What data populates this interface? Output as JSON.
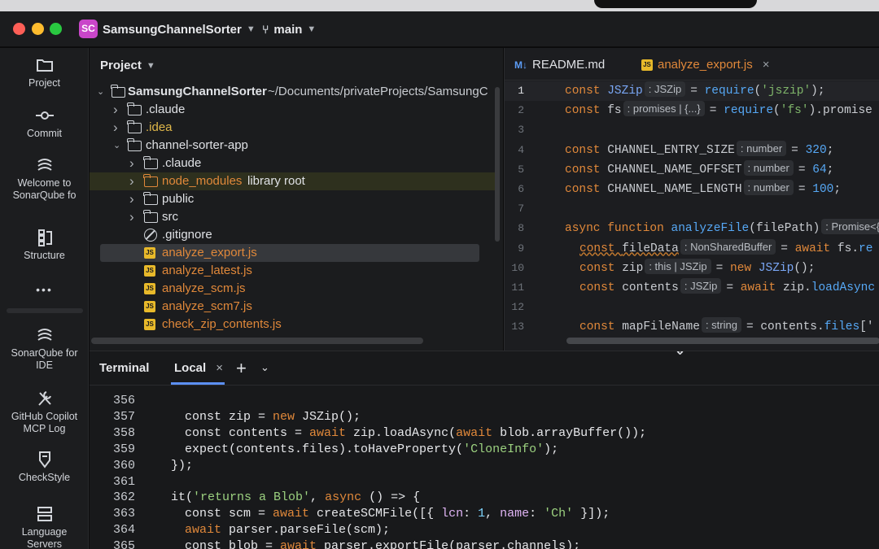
{
  "window": {
    "project_badge": "SC",
    "project_name": "SamsungChannelSorter",
    "branch": "main"
  },
  "toolstrip": {
    "items": [
      {
        "label": "Project",
        "icon": "folder-icon"
      },
      {
        "label": "Commit",
        "icon": "commit-icon"
      },
      {
        "label": "Welcome to SonarQube fo",
        "icon": "sonarqube-icon"
      },
      {
        "label": "Structure",
        "icon": "structure-icon"
      },
      {
        "label": "•••",
        "icon": "more-icon"
      },
      {
        "label": "SonarQube for IDE",
        "icon": "sonarqube-icon"
      },
      {
        "label": "GitHub Copilot MCP Log",
        "icon": "wrench-icon"
      },
      {
        "label": "CheckStyle",
        "icon": "checkstyle-icon"
      },
      {
        "label": "Language Servers",
        "icon": "servers-icon"
      }
    ]
  },
  "project_panel": {
    "title": "Project",
    "root": {
      "name": "SamsungChannelSorter",
      "path": "~/Documents/privateProjects/SamsungC"
    },
    "rows": [
      {
        "name": ".claude",
        "type": "folder",
        "level": 1,
        "arrow": "›"
      },
      {
        "name": ".idea",
        "type": "folder",
        "level": 1,
        "arrow": "›",
        "color": "#e0b84a"
      },
      {
        "name": "channel-sorter-app",
        "type": "folder",
        "level": 1,
        "arrow": "⌄"
      },
      {
        "name": ".claude",
        "type": "folder",
        "level": 2,
        "arrow": "›"
      },
      {
        "name": "node_modules",
        "type": "folder-orange",
        "level": 2,
        "arrow": "›",
        "suffix": "library root",
        "color": "#e0883a"
      },
      {
        "name": "public",
        "type": "folder",
        "level": 2,
        "arrow": "›"
      },
      {
        "name": "src",
        "type": "folder",
        "level": 2,
        "arrow": "›"
      },
      {
        "name": ".gitignore",
        "type": "ignore",
        "level": 2
      },
      {
        "name": "analyze_export.js",
        "type": "js",
        "level": 2,
        "color": "#e0883a"
      },
      {
        "name": "analyze_latest.js",
        "type": "js",
        "level": 2,
        "color": "#e0883a"
      },
      {
        "name": "analyze_scm.js",
        "type": "js",
        "level": 2,
        "color": "#e0883a"
      },
      {
        "name": "analyze_scm7.js",
        "type": "js",
        "level": 2,
        "color": "#e0883a"
      },
      {
        "name": "check_zip_contents.js",
        "type": "js",
        "level": 2,
        "color": "#e0883a"
      }
    ]
  },
  "editor": {
    "tabs": [
      {
        "badge": "M↓",
        "label": "README.md"
      },
      {
        "badge": "JS",
        "label": "analyze_export.js",
        "close": "×"
      }
    ],
    "lines": [
      {
        "n": "1",
        "parts": [
          [
            "kw",
            "const "
          ],
          [
            "blue",
            "JSZip"
          ],
          [
            "hint",
            ": JSZip"
          ],
          [
            "",
            "= "
          ],
          [
            "fn",
            "require"
          ],
          [
            "",
            "("
          ],
          [
            "str",
            "'jszip'"
          ],
          [
            "",
            ");"
          ]
        ]
      },
      {
        "n": "2",
        "parts": [
          [
            "kw",
            "const "
          ],
          [
            "",
            "fs"
          ],
          [
            "hint",
            ": promises | {...}"
          ],
          [
            "",
            "= "
          ],
          [
            "fn",
            "require"
          ],
          [
            "",
            "("
          ],
          [
            "str",
            "'fs'"
          ],
          [
            "",
            ").promise"
          ]
        ]
      },
      {
        "n": "3",
        "parts": []
      },
      {
        "n": "4",
        "parts": [
          [
            "kw",
            "const "
          ],
          [
            "",
            "CHANNEL_ENTRY_SIZE"
          ],
          [
            "hint",
            ": number"
          ],
          [
            "",
            "= "
          ],
          [
            "num",
            "320"
          ],
          [
            "",
            ";"
          ]
        ]
      },
      {
        "n": "5",
        "parts": [
          [
            "kw",
            "const "
          ],
          [
            "",
            "CHANNEL_NAME_OFFSET"
          ],
          [
            "hint",
            ": number"
          ],
          [
            "",
            "= "
          ],
          [
            "num",
            "64"
          ],
          [
            "",
            ";"
          ]
        ]
      },
      {
        "n": "6",
        "parts": [
          [
            "kw",
            "const "
          ],
          [
            "",
            "CHANNEL_NAME_LENGTH"
          ],
          [
            "hint",
            ": number"
          ],
          [
            "",
            "= "
          ],
          [
            "num",
            "100"
          ],
          [
            "",
            ";"
          ]
        ]
      },
      {
        "n": "7",
        "parts": []
      },
      {
        "n": "8",
        "parts": [
          [
            "kw",
            "async function "
          ],
          [
            "fn",
            "analyzeFile"
          ],
          [
            "",
            "(filePath)"
          ],
          [
            "hint",
            ": Promise<{"
          ]
        ]
      },
      {
        "n": "9",
        "indent": true,
        "parts": [
          [
            "kw squig",
            "const "
          ],
          [
            "squig",
            "fileData"
          ],
          [
            "hint",
            ": NonSharedBuffer"
          ],
          [
            "",
            "= "
          ],
          [
            "kw",
            "await "
          ],
          [
            "",
            "fs."
          ],
          [
            "fn",
            "re"
          ]
        ]
      },
      {
        "n": "10",
        "indent": true,
        "parts": [
          [
            "kw",
            "const "
          ],
          [
            "",
            "zip"
          ],
          [
            "hint",
            ": this | JSZip"
          ],
          [
            "",
            "= "
          ],
          [
            "kw",
            "new "
          ],
          [
            "blue",
            "JSZip"
          ],
          [
            "",
            "();"
          ]
        ]
      },
      {
        "n": "11",
        "indent": true,
        "parts": [
          [
            "kw",
            "const "
          ],
          [
            "",
            "contents"
          ],
          [
            "hint",
            ": JSZip"
          ],
          [
            "",
            "= "
          ],
          [
            "kw",
            "await "
          ],
          [
            "",
            "zip."
          ],
          [
            "fn",
            "loadAsync"
          ]
        ]
      },
      {
        "n": "12",
        "parts": []
      },
      {
        "n": "13",
        "indent": true,
        "parts": [
          [
            "kw",
            "const "
          ],
          [
            "",
            "mapFileName"
          ],
          [
            "hint",
            ": string"
          ],
          [
            "",
            "= "
          ],
          [
            "",
            "contents."
          ],
          [
            "fn",
            "files"
          ],
          [
            "",
            "['"
          ]
        ]
      }
    ]
  },
  "terminal": {
    "title": "Terminal",
    "tab_label": "Local",
    "tab_close": "×",
    "add_label": "+",
    "more_label": "⌄",
    "lines": [
      {
        "n": "356",
        "parts": []
      },
      {
        "n": "357",
        "i2": true,
        "parts": [
          [
            "",
            "const zip = "
          ],
          [
            "kw",
            "new "
          ],
          [
            "",
            "JSZip();"
          ]
        ]
      },
      {
        "n": "358",
        "i2": true,
        "parts": [
          [
            "",
            "const contents = "
          ],
          [
            "kw",
            "await "
          ],
          [
            "",
            "zip.loadAsync("
          ],
          [
            "kw",
            "await "
          ],
          [
            "",
            "blob.arrayBuffer());"
          ]
        ]
      },
      {
        "n": "359",
        "i2": true,
        "parts": [
          [
            "",
            "expect(contents.files).toHaveProperty("
          ],
          [
            "str",
            "'CloneInfo'"
          ],
          [
            "",
            ");"
          ]
        ]
      },
      {
        "n": "360",
        "parts": [
          [
            "",
            "});"
          ]
        ]
      },
      {
        "n": "361",
        "parts": []
      },
      {
        "n": "362",
        "parts": [
          [
            "",
            "it("
          ],
          [
            "str",
            "'returns a Blob'"
          ],
          [
            "",
            ", "
          ],
          [
            "kw",
            "async "
          ],
          [
            "",
            "() => {"
          ]
        ]
      },
      {
        "n": "363",
        "i2": true,
        "parts": [
          [
            "",
            "const scm = "
          ],
          [
            "kw",
            "await "
          ],
          [
            "",
            "createSCMFile([{ "
          ],
          [
            "prop",
            "lcn"
          ],
          [
            "",
            ": "
          ],
          [
            "num",
            "1"
          ],
          [
            "",
            ", "
          ],
          [
            "prop",
            "name"
          ],
          [
            "",
            ": "
          ],
          [
            "str",
            "'Ch'"
          ],
          [
            "",
            " }]);"
          ]
        ]
      },
      {
        "n": "364",
        "i2": true,
        "parts": [
          [
            "kw",
            "await "
          ],
          [
            "",
            "parser.parseFile(scm);"
          ]
        ]
      },
      {
        "n": "365",
        "i2": true,
        "parts": [
          [
            "",
            "const blob = "
          ],
          [
            "kw",
            "await "
          ],
          [
            "",
            "parser.exportFile(parser.channels);"
          ]
        ]
      }
    ]
  },
  "colors": {
    "keyword": "#e0883a",
    "accent": "#5c8ff5",
    "js_badge": "#e8b92a",
    "string": "#7fb56a"
  }
}
